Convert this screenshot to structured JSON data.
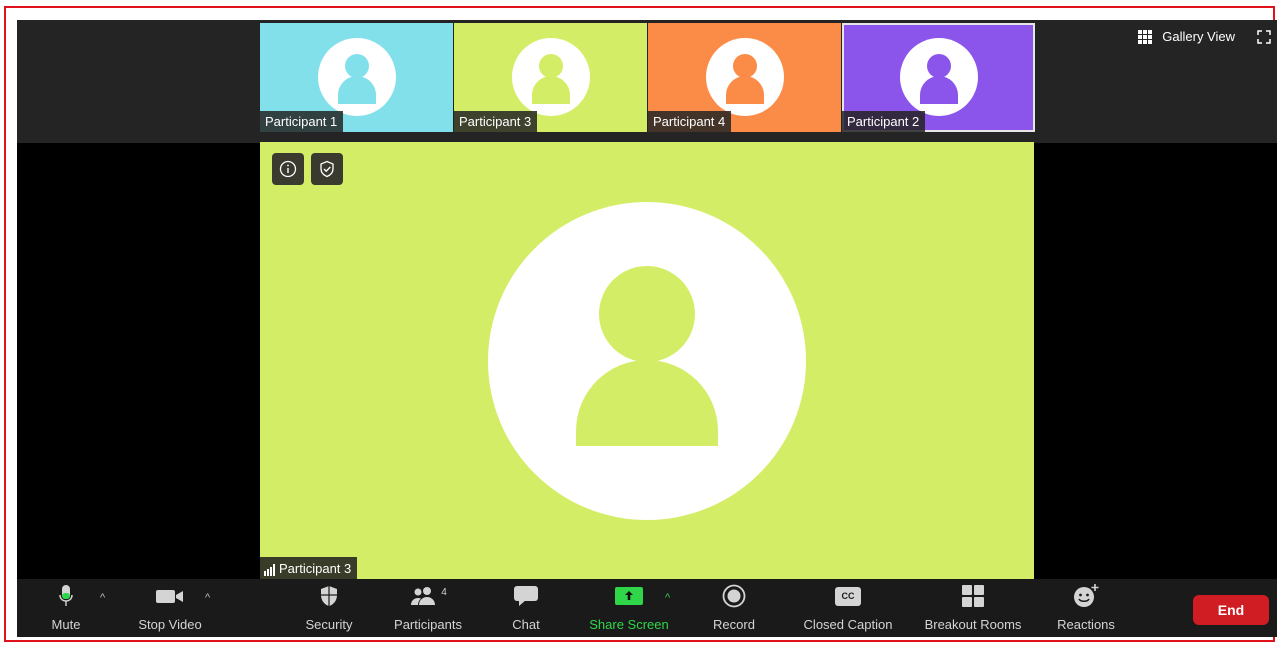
{
  "strip": {
    "participants": [
      {
        "name": "Participant 1",
        "bg": "#82e0ea",
        "accent": "#82e0ea"
      },
      {
        "name": "Participant 3",
        "bg": "#d4ed66",
        "accent": "#d4ed66"
      },
      {
        "name": "Participant 4",
        "bg": "#fb8c48",
        "accent": "#fb8c48"
      },
      {
        "name": "Participant 2",
        "bg": "#8b55ec",
        "accent": "#8b55ec"
      }
    ],
    "gallery_view_label": "Gallery View"
  },
  "main": {
    "speaker_name": "Participant 3",
    "bg": "#d4ed66"
  },
  "toolbar": {
    "mute_label": "Mute",
    "stop_video_label": "Stop Video",
    "security_label": "Security",
    "participants_label": "Participants",
    "participants_count": "4",
    "chat_label": "Chat",
    "share_screen_label": "Share Screen",
    "record_label": "Record",
    "closed_caption_label": "Closed Caption",
    "cc_icon_text": "CC",
    "breakout_rooms_label": "Breakout Rooms",
    "reactions_label": "Reactions",
    "end_label": "End"
  },
  "colors": {
    "share_green": "#2fd64a",
    "end_red": "#cf1d23",
    "frame_red": "#e0121b"
  }
}
